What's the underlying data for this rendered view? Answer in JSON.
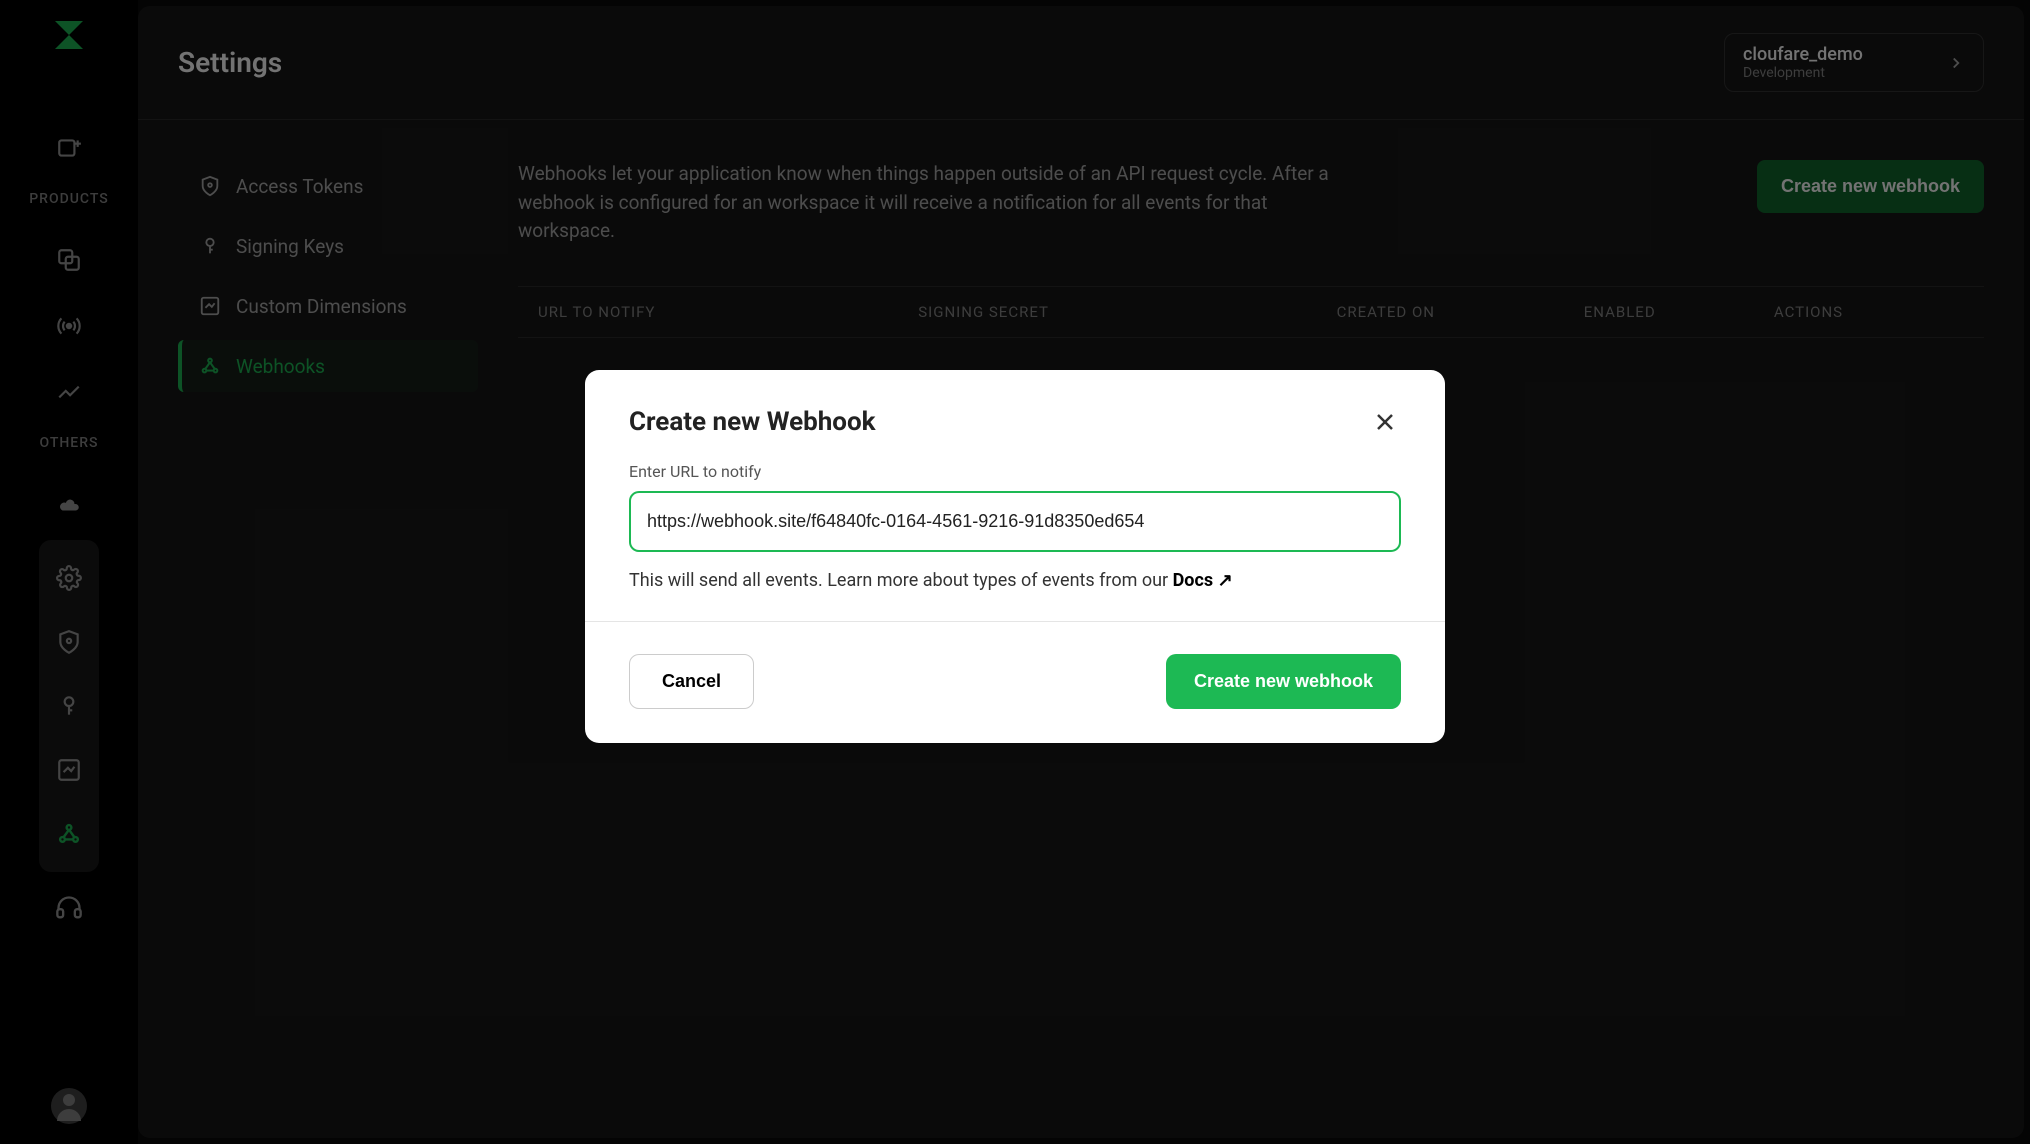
{
  "sidebar": {
    "section1": "PRODUCTS",
    "section2": "OTHERS"
  },
  "topbar": {
    "title": "Settings",
    "workspace_name": "cloufare_demo",
    "workspace_env": "Development"
  },
  "settings_nav": {
    "items": [
      {
        "label": "Access Tokens"
      },
      {
        "label": "Signing Keys"
      },
      {
        "label": "Custom Dimensions"
      },
      {
        "label": "Webhooks"
      }
    ]
  },
  "webhooks": {
    "description": "Webhooks let your application know when things happen outside of an API request cycle. After a webhook is configured for an workspace it will receive a notification for all events for that workspace.",
    "create_button": "Create new webhook",
    "table": {
      "col_url": "URL TO NOTIFY",
      "col_secret": "SIGNING SECRET",
      "col_created": "CREATED ON",
      "col_enabled": "ENABLED",
      "col_actions": "ACTIONS"
    }
  },
  "modal": {
    "title": "Create new Webhook",
    "label": "Enter URL to notify",
    "input_value": "https://webhook.site/f64840fc-0164-4561-9216-91d8350ed654",
    "help_text": "This will send all events. Learn more about types of events from our ",
    "docs_label": "Docs",
    "cancel": "Cancel",
    "submit": "Create new webhook"
  }
}
